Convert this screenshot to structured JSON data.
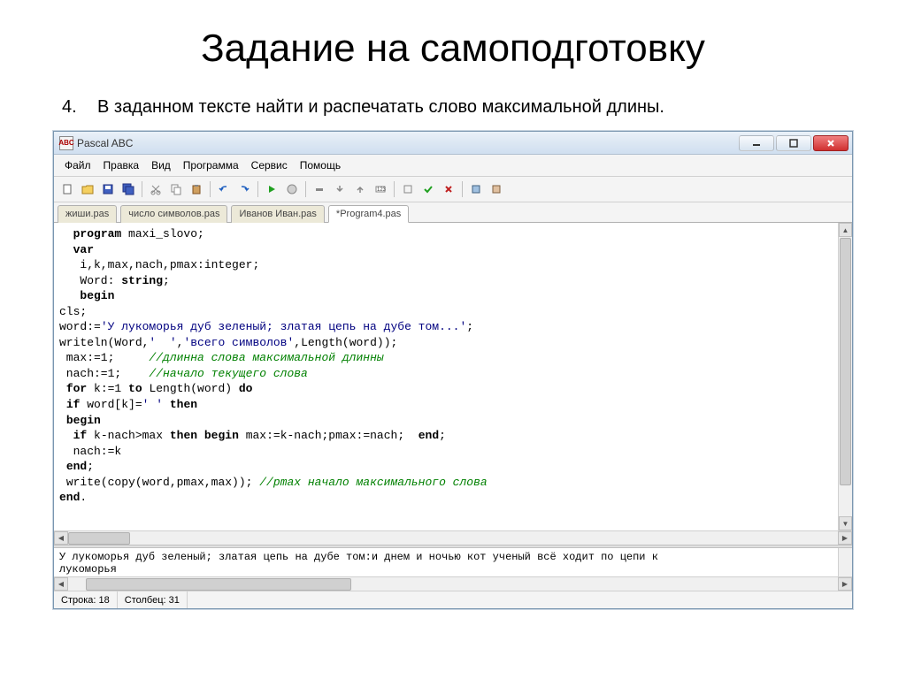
{
  "slide": {
    "title": "Задание на самоподготовку",
    "task_number": "4.",
    "task_text": "В заданном тексте найти и распечатать слово максимальной длины."
  },
  "app": {
    "title": "Pascal ABC",
    "icon_label": "ABC"
  },
  "menu": {
    "file": "Файл",
    "edit": "Правка",
    "view": "Вид",
    "program": "Программа",
    "service": "Сервис",
    "help": "Помощь"
  },
  "tabs": [
    {
      "label": "жиши.pas",
      "active": false
    },
    {
      "label": "число символов.pas",
      "active": false
    },
    {
      "label": "Иванов Иван.pas",
      "active": false
    },
    {
      "label": "*Program4.pas",
      "active": true
    }
  ],
  "code": {
    "l1": {
      "indent": "  ",
      "kw1": "program",
      "rest": " maxi_slovo;"
    },
    "l2": {
      "indent": "  ",
      "kw1": "var"
    },
    "l3": {
      "indent": "   ",
      "text": "i,k,max,nach,pmax:integer;"
    },
    "l4": {
      "indent": "   ",
      "text1": "Word: ",
      "kw": "string",
      "text2": ";"
    },
    "l5": {
      "indent": "   ",
      "kw1": "begin"
    },
    "l6": "cls;",
    "l7": {
      "text1": "word:=",
      "str": "'У лукоморья дуб зеленый; златая цепь на дубе том...'",
      "text2": ";"
    },
    "l8": {
      "text1": "writeln(Word,",
      "str1": "'  '",
      "text2": ",",
      "str2": "'всего символов'",
      "text3": ",Length(word));"
    },
    "l9": {
      "text1": " max:=1;     ",
      "cm": "//длинна слова максимальной длинны"
    },
    "l10": {
      "text1": " nach:=1;    ",
      "cm": "//начало текущего слова"
    },
    "l11": {
      "indent": " ",
      "kw1": "for",
      "t1": " k:=1 ",
      "kw2": "to",
      "t2": " Length(word) ",
      "kw3": "do"
    },
    "l12": {
      "indent": " ",
      "kw1": "if",
      "t1": " word[k]=",
      "str": "' '",
      "t2": " ",
      "kw2": "then"
    },
    "l13": {
      "indent": " ",
      "kw1": "begin"
    },
    "l14": {
      "indent": "  ",
      "kw1": "if",
      "t1": " k-nach>max ",
      "kw2": "then",
      "t2": " ",
      "kw3": "begin",
      "t3": " max:=k-nach;pmax:=nach;  ",
      "kw4": "end",
      "t4": ";"
    },
    "l15": "  nach:=k",
    "l16": {
      "indent": " ",
      "kw1": "end",
      "t1": ";"
    },
    "l17": {
      "indent": " ",
      "t1": "write(copy(word,pmax,max)); ",
      "cm": "//pmax начало максимального слова"
    },
    "l18": {
      "kw1": "end",
      "t1": "."
    }
  },
  "output": {
    "text": "У лукоморья дуб зеленый; златая цепь на дубе том:и днем и ночью кот ученый всё ходит по цепи к\nлукоморья"
  },
  "status": {
    "line": "Строка: 18",
    "col": "Столбец: 31"
  }
}
